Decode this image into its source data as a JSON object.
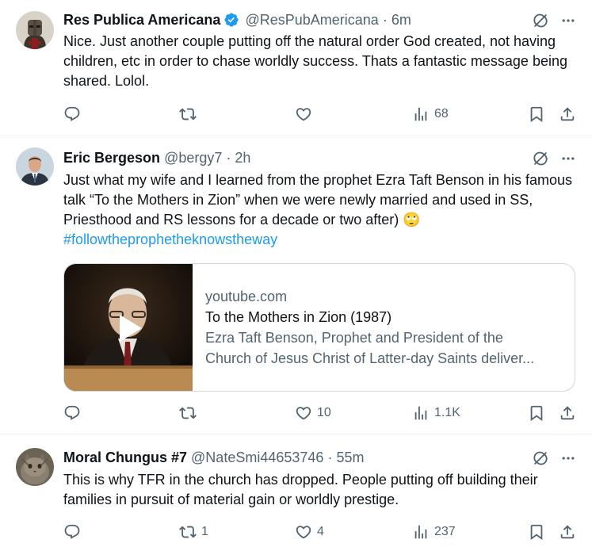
{
  "colors": {
    "accent": "#1d9bf0",
    "muted": "#536471",
    "text": "#0f1419",
    "divider": "#eff3f4"
  },
  "tweets": [
    {
      "name": "Res Publica Americana",
      "verified": true,
      "handle": "@ResPubAmericana",
      "time": "6m",
      "text": "Nice. Just another couple putting off the natural order God created, not having children, etc in order to chase worldly success. Thats a fantastic message being shared. Lolol.",
      "stats": {
        "replies": "",
        "reposts": "",
        "likes": "",
        "views": "68"
      }
    },
    {
      "name": "Eric Bergeson",
      "verified": false,
      "handle": "@bergy7",
      "time": "2h",
      "text": "Just what my wife and I learned from the prophet Ezra Taft Benson in his famous talk “To the Mothers in Zion” when we were newly married and used in SS, Priesthood and RS lessons for a decade or two after) 🙄",
      "hashtag": "#followtheprophetheknowstheway",
      "card": {
        "domain": "youtube.com",
        "title": "To the Mothers in Zion (1987)",
        "desc_line1": "Ezra Taft Benson, Prophet and President of the",
        "desc_line2": "Church of Jesus Christ of Latter-day Saints deliver..."
      },
      "stats": {
        "replies": "",
        "reposts": "",
        "likes": "10",
        "views": "1.1K"
      }
    },
    {
      "name": "Moral Chungus #7",
      "verified": false,
      "handle": "@NateSmi44653746",
      "time": "55m",
      "text": "This is why TFR in the church has dropped. People putting off building their families in pursuit of material gain or worldly prestige.",
      "stats": {
        "replies": "",
        "reposts": "1",
        "likes": "4",
        "views": "237"
      }
    }
  ],
  "separator": "·"
}
